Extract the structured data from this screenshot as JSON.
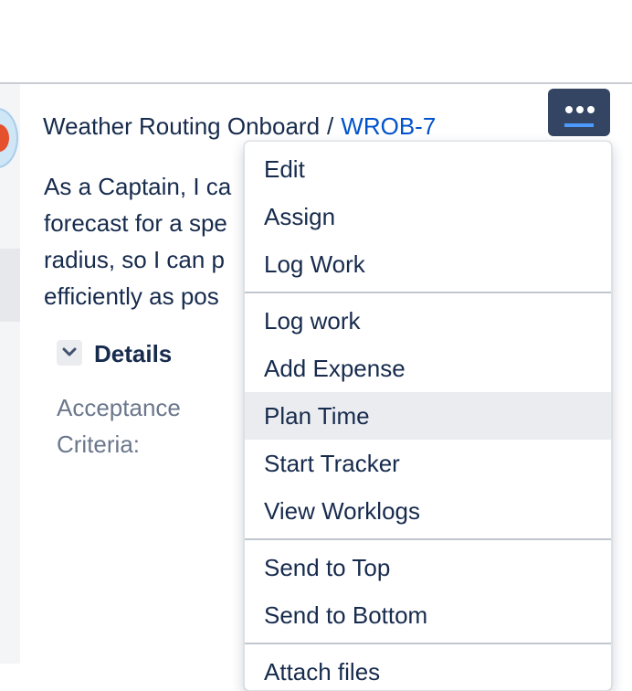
{
  "breadcrumb": {
    "project": "Weather Routing Onboard",
    "separator": "/",
    "issue_key": "WROB-7"
  },
  "description": {
    "text": "As a Captain, I ca\nforecast for a spe\nradius, so I can p\nefficiently as pos"
  },
  "details": {
    "title": "Details",
    "acceptance_label": "Acceptance\nCriteria:"
  },
  "more_button": {
    "icon": "more-horizontal-icon"
  },
  "menu": {
    "group1": [
      "Edit",
      "Assign",
      "Log Work"
    ],
    "group2": [
      "Log work",
      "Add Expense",
      "Plan Time",
      "Start Tracker",
      "View Worklogs"
    ],
    "group3": [
      "Send to Top",
      "Send to Bottom"
    ],
    "group4": [
      "Attach files"
    ],
    "highlighted": "Plan Time"
  },
  "colors": {
    "link": "#0052cc",
    "text": "#172b4d",
    "button_bg": "#344563",
    "menu_highlight": "#ebecf0"
  }
}
